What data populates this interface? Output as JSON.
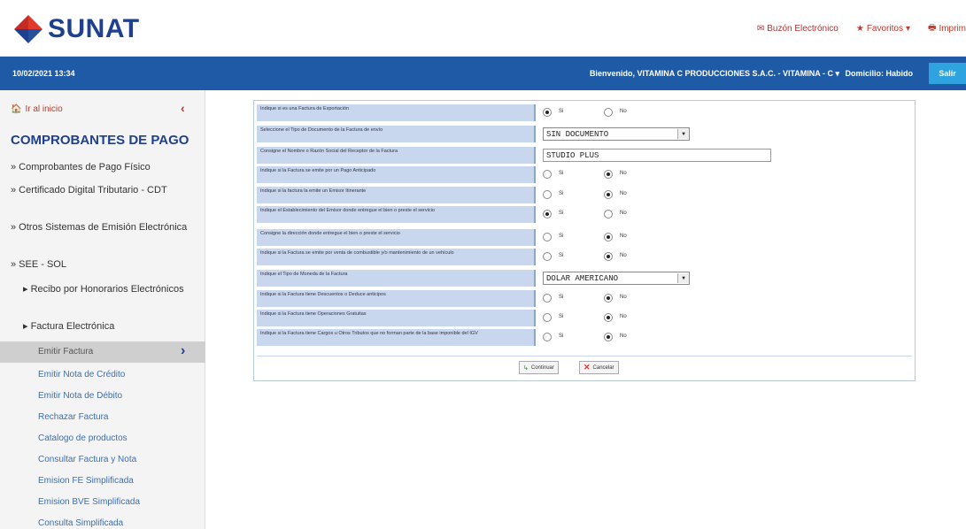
{
  "header": {
    "logo_text": "SUNAT",
    "links": [
      {
        "label": "Buzón Electrónico",
        "icon": "envelope-icon"
      },
      {
        "label": "Favoritos",
        "icon": "star-icon"
      },
      {
        "label": "Imprim",
        "icon": "printer-icon"
      }
    ]
  },
  "bluebar": {
    "datetime": "10/02/2021 13:34",
    "welcome": "Bienvenido, VITAMINA C PRODUCCIONES S.A.C. - VITAMINA - C",
    "domicilio": "Domicilio: Habido",
    "salir_label": "Salir"
  },
  "sidebar": {
    "home_label": "Ir al inicio",
    "title": "COMPROBANTES DE PAGO",
    "items": [
      "» Comprobantes de Pago Físico",
      "» Certificado Digital Tributario - CDT",
      "» Otros Sistemas de Emisión Electrónica",
      "» SEE - SOL"
    ],
    "sub_items": [
      "▸ Recibo por Honorarios Electrónicos",
      "▸ Factura Electrónica"
    ],
    "active_leaf": "Emitir Factura",
    "leaves": [
      "Emitir Nota de Crédito",
      "Emitir Nota de Débito",
      "Rechazar Factura",
      "Catalogo de productos",
      "Consultar Factura y Nota",
      "Emision FE Simplificada",
      "Emision BVE Simplificada",
      "Consulta Simplificada"
    ]
  },
  "form": {
    "rows": [
      {
        "label": "Indique si es una Factura de Exportación",
        "type": "radio",
        "selected": "si"
      },
      {
        "label": "Seleccione el Tipo de Documento de la Factura de envío",
        "type": "select",
        "value": "SIN DOCUMENTO"
      },
      {
        "label": "Consigne el Nombre o Razón Social del Receptor de la Factura",
        "type": "text",
        "value": "STUDIO PLUS"
      },
      {
        "label": "Indique si la Factura se emite por un Pago Anticipado",
        "type": "radio",
        "selected": "no"
      },
      {
        "label": "Indique si la factura la emite un Emisor Itinerante",
        "type": "radio",
        "selected": "no"
      },
      {
        "label": "Indique el Establecimiento del Emisor donde entregue el bien o preste el servicio",
        "type": "radio",
        "selected": "si"
      },
      {
        "label": "Consigne la dirección donde entregue el bien o preste el servicio",
        "type": "radio",
        "selected": "no"
      },
      {
        "label": "Indique si la Factura se emite por venta de combustible y/o mantenimiento de un vehículo",
        "type": "radio",
        "selected": "no"
      },
      {
        "label": "Indique el Tipo de Moneda de la Factura",
        "type": "select",
        "value": "DOLAR AMERICANO"
      },
      {
        "label": "Indique si la Factura tiene Descuentos o Deduce anticipos",
        "type": "radio",
        "selected": "no"
      },
      {
        "label": "Indique si la Factura tiene Operaciones Gratuitas",
        "type": "radio",
        "selected": "no"
      },
      {
        "label": "Indique si la Factura tiene Cargos u Otros Tributos que no forman parte de la base imponible del IGV",
        "type": "radio",
        "selected": "no"
      }
    ],
    "radio_si": "Si",
    "radio_no": "No",
    "continue_label": "Continuar",
    "cancel_label": "Cancelar"
  }
}
